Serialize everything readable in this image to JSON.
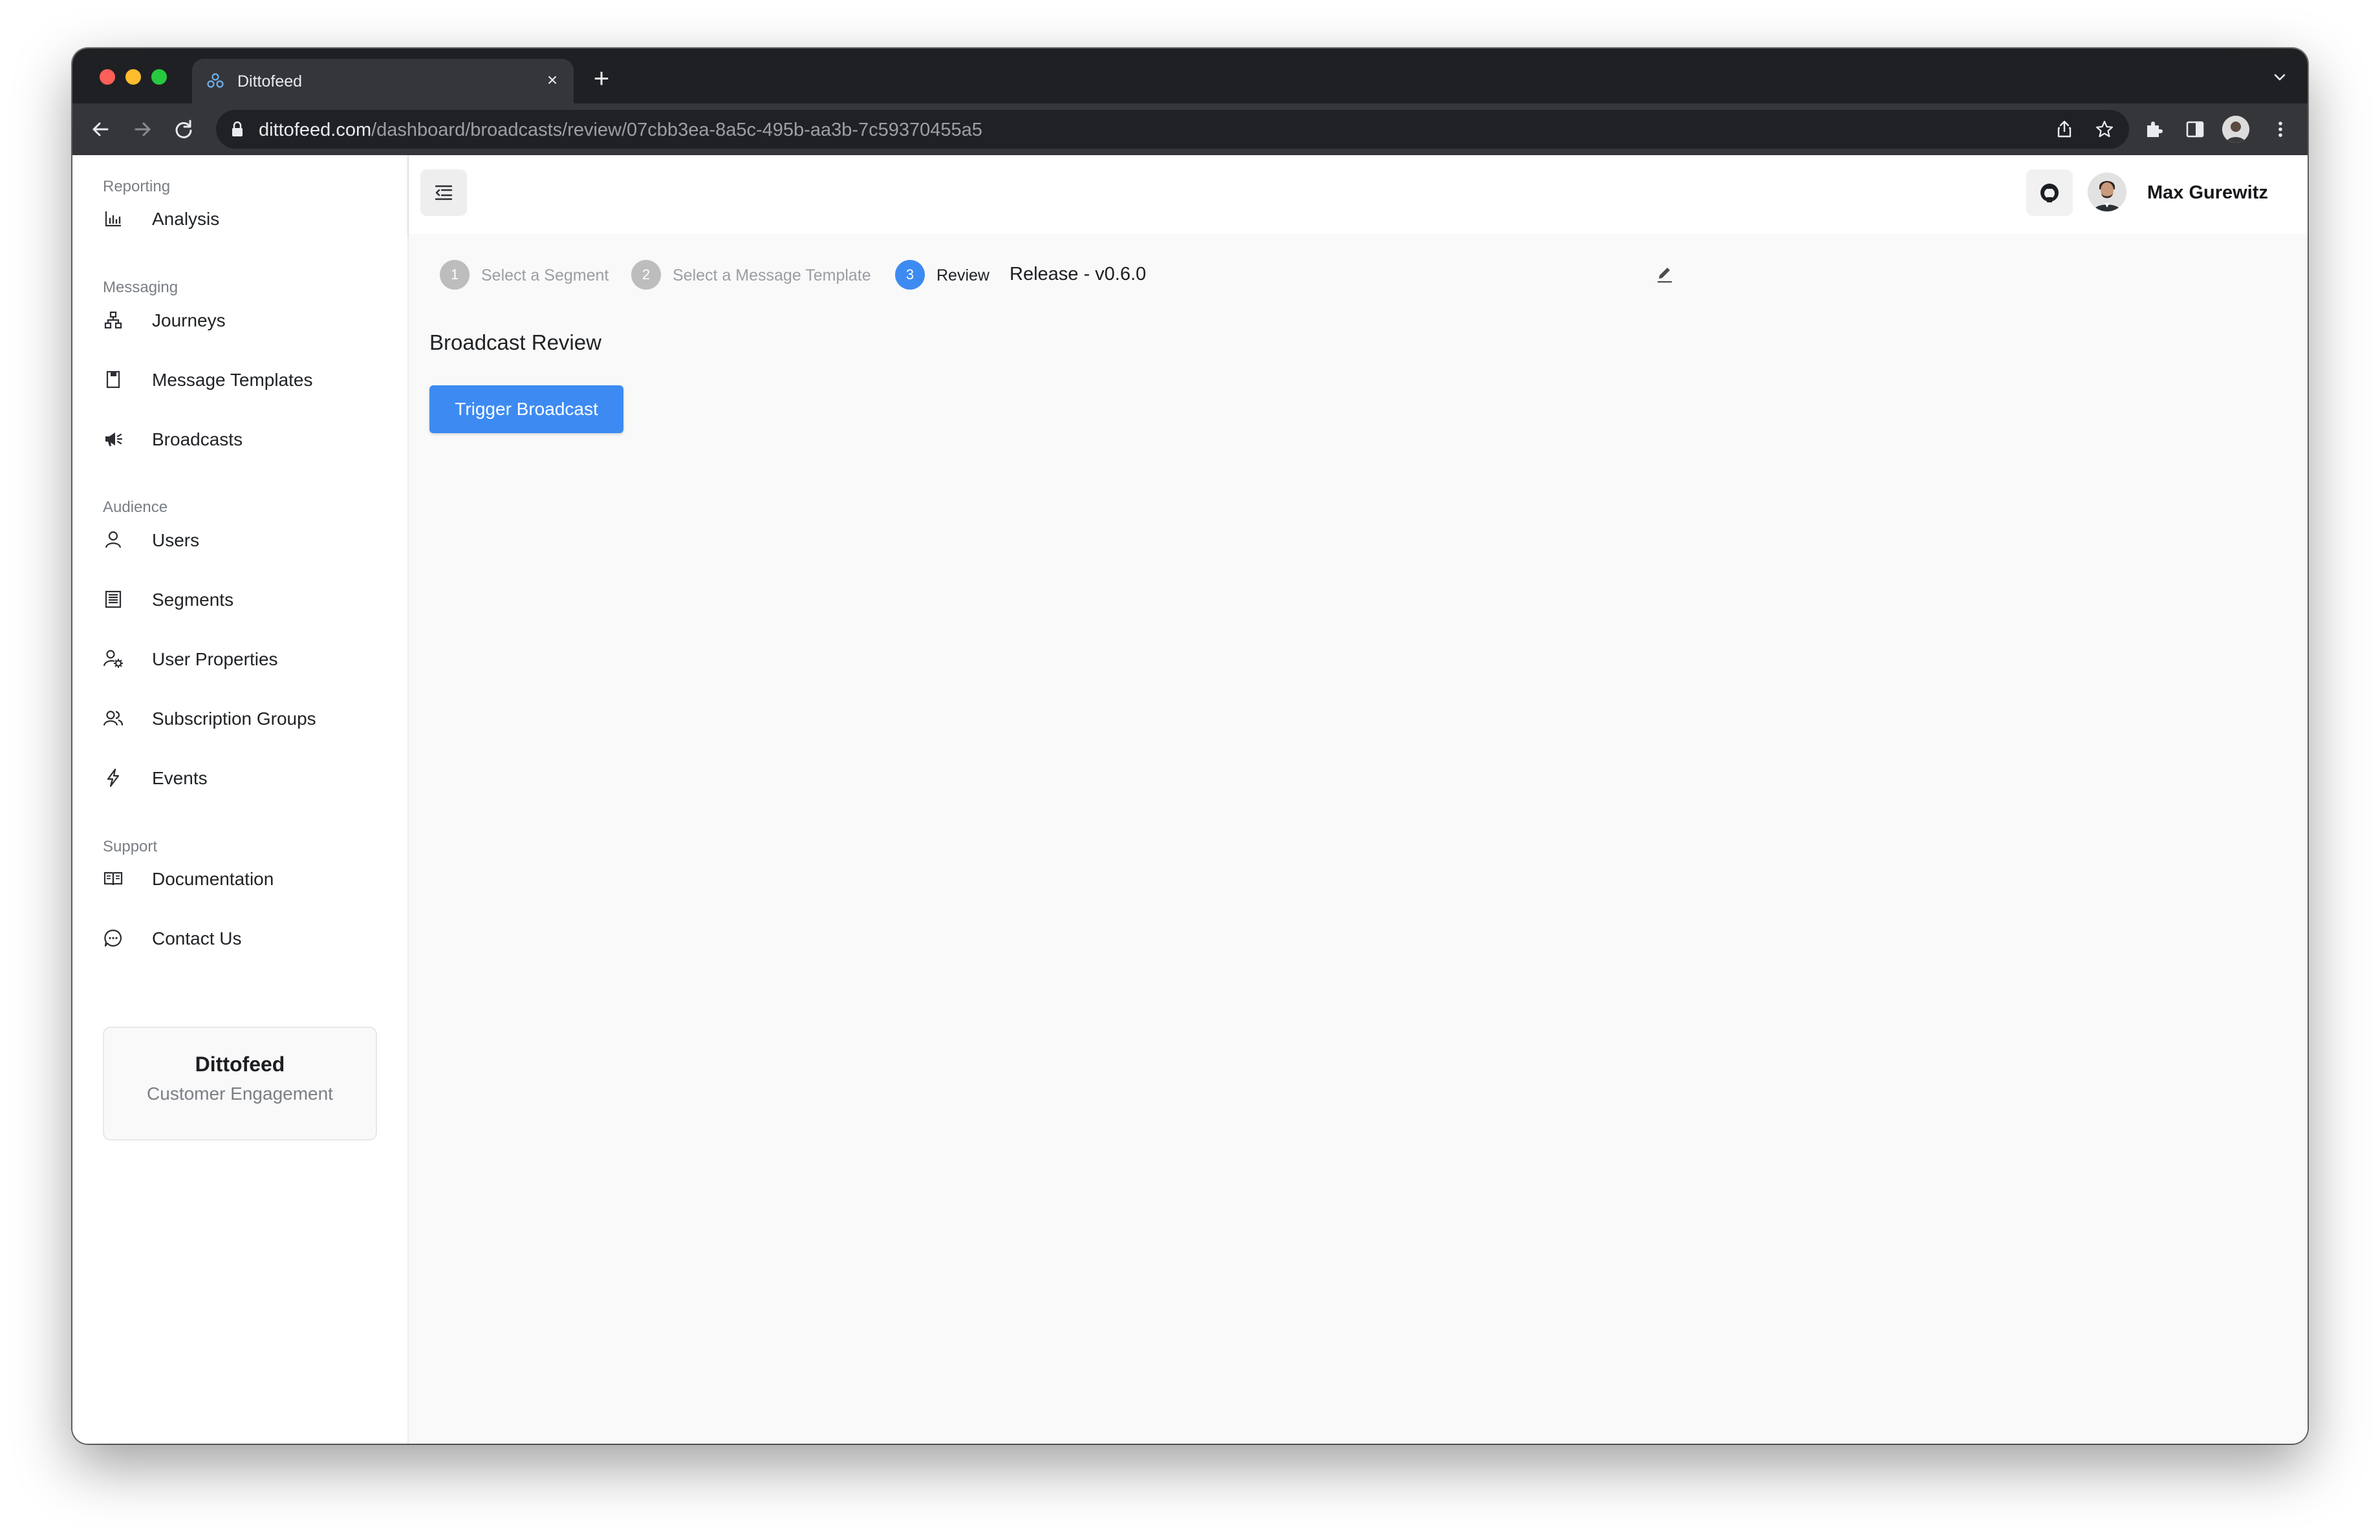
{
  "browser": {
    "tab_title": "Dittofeed",
    "new_tab_glyph": "+",
    "close_glyph": "×",
    "url_host": "dittofeed.com",
    "url_path": "/dashboard/broadcasts/review/07cbb3ea-8a5c-495b-aa3b-7c59370455a5"
  },
  "sidebar": {
    "sections": [
      {
        "label": "Reporting",
        "items": [
          {
            "label": "Analysis",
            "icon": "bar-chart-icon"
          }
        ]
      },
      {
        "label": "Messaging",
        "items": [
          {
            "label": "Journeys",
            "icon": "hierarchy-icon"
          },
          {
            "label": "Message Templates",
            "icon": "document-icon"
          },
          {
            "label": "Broadcasts",
            "icon": "megaphone-icon"
          }
        ]
      },
      {
        "label": "Audience",
        "items": [
          {
            "label": "Users",
            "icon": "user-icon"
          },
          {
            "label": "Segments",
            "icon": "segments-icon"
          },
          {
            "label": "User Properties",
            "icon": "user-settings-icon"
          },
          {
            "label": "Subscription Groups",
            "icon": "users-group-icon"
          },
          {
            "label": "Events",
            "icon": "bolt-icon"
          }
        ]
      },
      {
        "label": "Support",
        "items": [
          {
            "label": "Documentation",
            "icon": "book-icon"
          },
          {
            "label": "Contact Us",
            "icon": "chat-icon"
          }
        ]
      }
    ],
    "promo": {
      "title": "Dittofeed",
      "subtitle": "Customer Engagement"
    }
  },
  "header": {
    "user_name": "Max Gurewitz"
  },
  "stepper": {
    "steps": [
      {
        "number": "1",
        "label": "Select a Segment",
        "state": "inactive"
      },
      {
        "number": "2",
        "label": "Select a Message Template",
        "state": "inactive"
      },
      {
        "number": "3",
        "label": "Review",
        "state": "active"
      }
    ],
    "broadcast_name": "Release - v0.6.0"
  },
  "main": {
    "heading": "Broadcast Review",
    "trigger_button_label": "Trigger Broadcast"
  },
  "colors": {
    "accent": "#3d8bf2",
    "step_inactive": "#bdbdbd",
    "chrome_dark": "#1f2023"
  }
}
